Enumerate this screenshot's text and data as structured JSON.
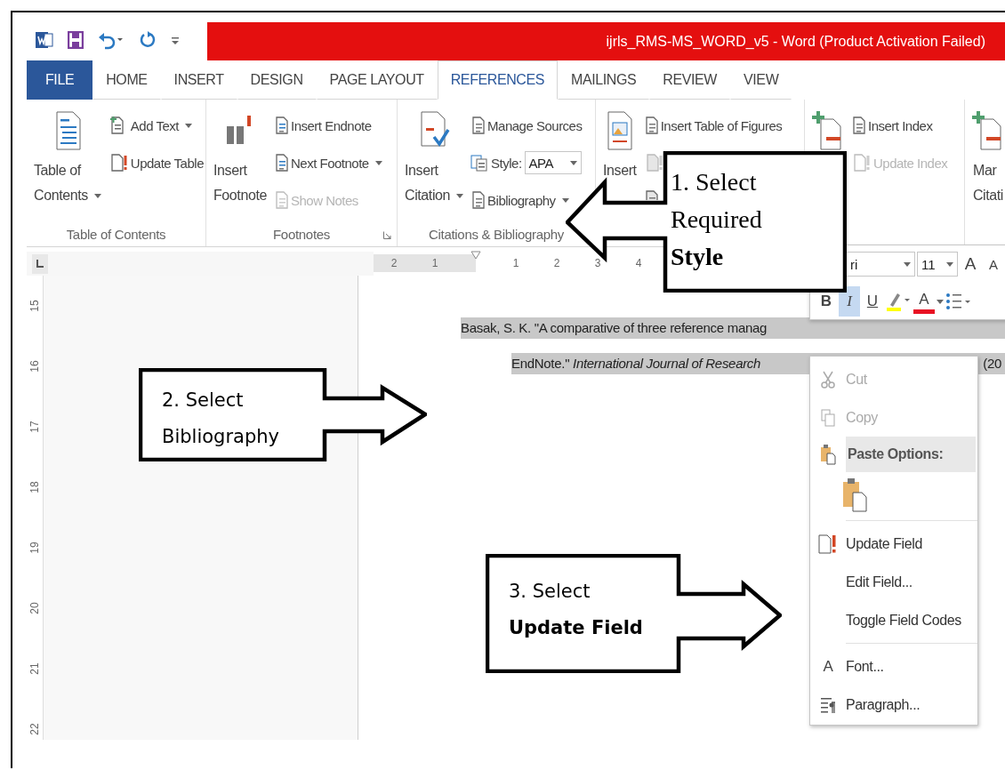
{
  "title_bar": {
    "title": "ijrls_RMS-MS_WORD_v5 - Word (Product Activation Failed)"
  },
  "tabs": [
    {
      "label": "FILE",
      "kind": "backstage",
      "selected": false
    },
    {
      "label": "HOME",
      "kind": "tab",
      "selected": false
    },
    {
      "label": "INSERT",
      "kind": "tab",
      "selected": false
    },
    {
      "label": "DESIGN",
      "kind": "tab",
      "selected": false
    },
    {
      "label": "PAGE LAYOUT",
      "kind": "tab",
      "selected": false
    },
    {
      "label": "REFERENCES",
      "kind": "tab",
      "selected": true
    },
    {
      "label": "MAILINGS",
      "kind": "tab",
      "selected": false
    },
    {
      "label": "REVIEW",
      "kind": "tab",
      "selected": false
    },
    {
      "label": "VIEW",
      "kind": "tab",
      "selected": false
    }
  ],
  "ribbon_groups": [
    {
      "label": "Table of Contents",
      "large": [
        {
          "kind": "labeled",
          "lines": [
            "Table of",
            "Contents"
          ],
          "dropdown": true
        }
      ],
      "small": [
        {
          "kind": "button",
          "label": "Add Text",
          "dropdown": true,
          "disabled": false
        },
        {
          "kind": "button",
          "label": "Update Table",
          "disabled": false
        }
      ]
    },
    {
      "label": "Footnotes",
      "launcher": true,
      "large": [
        {
          "kind": "labeled",
          "lines": [
            "Insert",
            "Footnote"
          ]
        }
      ],
      "small": [
        {
          "kind": "button",
          "label": "Insert Endnote",
          "disabled": false
        },
        {
          "kind": "button",
          "label": "Next Footnote",
          "dropdown": true,
          "disabled": false
        },
        {
          "kind": "button",
          "label": "Show Notes",
          "disabled": true
        }
      ]
    },
    {
      "label": "Citations & Bibliography",
      "large": [
        {
          "kind": "labeled",
          "lines": [
            "Insert",
            "Citation"
          ],
          "dropdown": true
        }
      ],
      "small": [
        {
          "kind": "button",
          "label": "Manage Sources",
          "disabled": false
        },
        {
          "kind": "select",
          "label": "Style:",
          "value": "APA"
        },
        {
          "kind": "button",
          "label": "Bibliography",
          "dropdown": true,
          "disabled": false
        }
      ]
    },
    {
      "large": [
        {
          "kind": "labeled",
          "lines": [
            "Insert"
          ]
        }
      ],
      "small": [
        {
          "kind": "button",
          "label": "Insert Table of Figures",
          "disabled": false
        },
        {
          "kind": "icon_only",
          "disabled": true
        },
        {
          "kind": "icon_only",
          "disabled": false
        }
      ]
    },
    {
      "large": [
        {
          "kind": "icon_only"
        }
      ],
      "small": [
        {
          "kind": "button",
          "label": "Insert Index",
          "disabled": false
        },
        {
          "kind": "button",
          "label": "Update Index",
          "disabled": true
        }
      ]
    },
    {
      "large": [
        {
          "kind": "labeled",
          "lines": [
            "Mar",
            "Citati"
          ]
        }
      ]
    }
  ],
  "ruler": {
    "horizontal": [
      "2",
      "1",
      "1",
      "2",
      "3",
      "4"
    ],
    "vertical": [
      "15",
      "16",
      "17",
      "18",
      "19",
      "20",
      "21",
      "22"
    ]
  },
  "document": {
    "line_1": "Basak, S. K. \"A comparative of three reference manag",
    "line_2": "EndNote.\" *International Journal of Research*",
    "line_2_tail": "(20"
  },
  "mini_toolbar": {
    "font_name": "ri",
    "font_size": "11",
    "size_buttons": [
      "A",
      "A"
    ],
    "buttons": [
      {
        "label": "B",
        "selected": false
      },
      {
        "label": "I",
        "selected": true
      },
      {
        "label": "U",
        "selected": false
      }
    ],
    "font_color": "A"
  },
  "context_menu": [
    {
      "kind": "item",
      "label": "Cut",
      "disabled": true
    },
    {
      "kind": "item",
      "label": "Copy",
      "disabled": true
    },
    {
      "kind": "header",
      "label": "Paste Options:"
    },
    {
      "kind": "paste_icons"
    },
    {
      "kind": "separator"
    },
    {
      "kind": "item",
      "label": "Update Field",
      "disabled": false
    },
    {
      "kind": "item",
      "label": "Edit Field...",
      "disabled": false
    },
    {
      "kind": "item",
      "label": "Toggle Field Codes",
      "disabled": false
    },
    {
      "kind": "separator"
    },
    {
      "kind": "item",
      "label": "Font...",
      "glyph": "A",
      "disabled": false
    },
    {
      "kind": "item",
      "label": "Paragraph...",
      "disabled": false
    }
  ],
  "callouts": [
    {
      "lines": [
        "1. Select",
        "Required",
        "**Style**"
      ]
    },
    {
      "lines": [
        "2. Select",
        "Bibliography"
      ]
    },
    {
      "lines": [
        "3. Select",
        "**Update Field**"
      ]
    }
  ]
}
